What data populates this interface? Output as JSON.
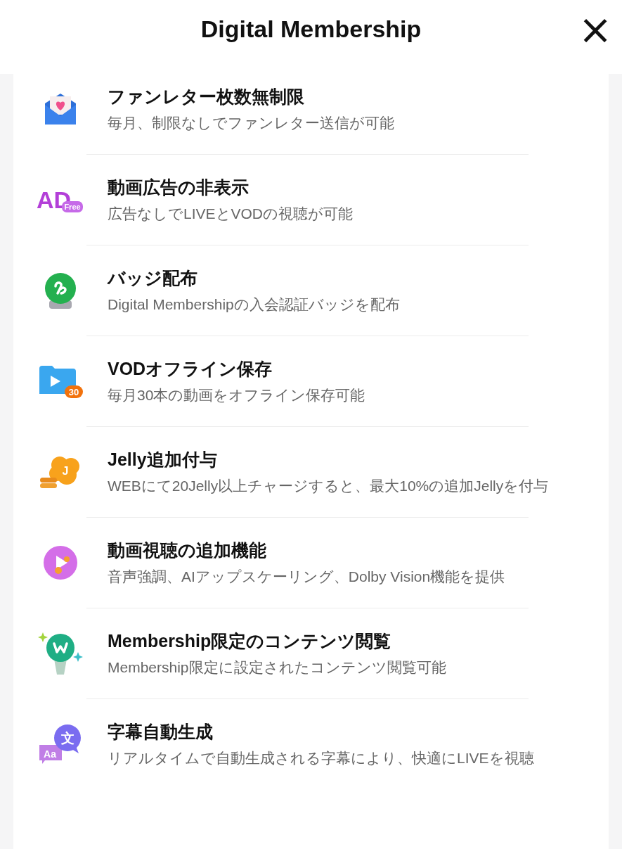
{
  "header": {
    "title": "Digital Membership",
    "close": "×"
  },
  "benefits": [
    {
      "title": "ファンレター枚数無制限",
      "description": "毎月、制限なしでファンレター送信が可能",
      "icon": {
        "kind": "letter"
      }
    },
    {
      "title": "動画広告の非表示",
      "description": "広告なしでLIVEとVODの視聴が可能",
      "icon": {
        "kind": "ad",
        "texts": [
          "AD",
          "Free"
        ]
      }
    },
    {
      "title": "バッジ配布",
      "description": "Digital Membershipの入会認証バッジを配布",
      "icon": {
        "kind": "badge"
      }
    },
    {
      "title": "VODオフライン保存",
      "description": "毎月30本の動画をオフライン保存可能",
      "icon": {
        "kind": "folder",
        "texts": [
          "30"
        ]
      }
    },
    {
      "title": "Jelly追加付与",
      "description": "WEBにて20Jelly以上チャージすると、最大10%の追加Jellyを付与",
      "icon": {
        "kind": "jelly",
        "texts": [
          "J"
        ]
      }
    },
    {
      "title": "動画視聴の追加機能",
      "description": "音声強調、AIアップスケーリング、Dolby Vision機能を提供",
      "icon": {
        "kind": "play"
      }
    },
    {
      "title": "Membership限定のコンテンツ閲覧",
      "description": "Membership限定に設定されたコンテンツ閲覧可能",
      "icon": {
        "kind": "lightstick"
      }
    },
    {
      "title": "字幕自動生成",
      "description": "リアルタイムで自動生成される字幕により、快適にLIVEを視聴",
      "icon": {
        "kind": "translate",
        "texts": [
          "文",
          "Aa"
        ]
      }
    }
  ]
}
